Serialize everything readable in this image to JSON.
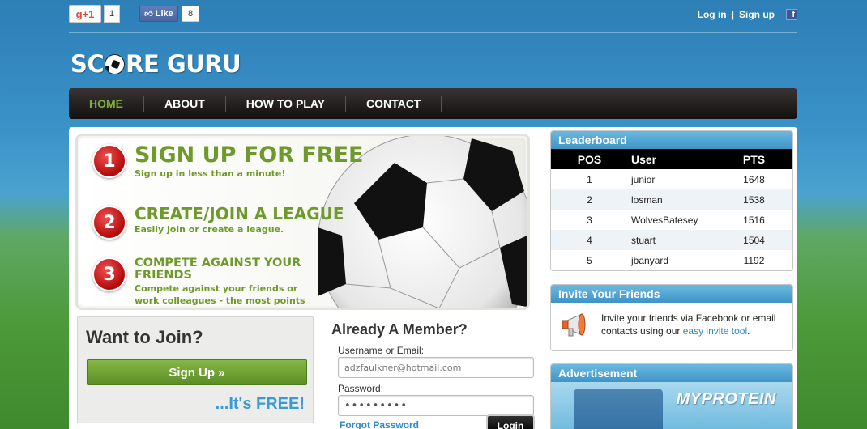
{
  "social": {
    "gplus_label": "+1",
    "gplus_icon": "g",
    "gplus_count": "1",
    "fb_like_label": "Like",
    "fb_like_count": "8"
  },
  "auth_links": {
    "login": "Log in",
    "separator": "|",
    "signup": "Sign up",
    "fb_icon": "f"
  },
  "logo": {
    "part1": "SC",
    "part2": "RE GURU"
  },
  "nav": [
    {
      "label": "HOME",
      "active": true
    },
    {
      "label": "ABOUT"
    },
    {
      "label": "HOW TO PLAY"
    },
    {
      "label": "CONTACT"
    }
  ],
  "hero": {
    "steps": [
      {
        "num": "1",
        "title": "SIGN UP FOR FREE",
        "sub": "Sign up in less than a minute!"
      },
      {
        "num": "2",
        "title": "CREATE/JOIN A LEAGUE",
        "sub": "Easily join or create a league."
      },
      {
        "num": "3",
        "title": "COMPETE AGAINST YOUR FRIENDS",
        "sub": "Compete against your friends or work colleagues - the most points wins!"
      }
    ]
  },
  "join": {
    "title": "Want to Join?",
    "button": "Sign Up »",
    "free": "...It's FREE!"
  },
  "member": {
    "title": "Already A Member?",
    "username_label": "Username or Email:",
    "username_value": "adzfaulkner@hotmail.com",
    "password_label": "Password:",
    "password_value": "•••••••••",
    "forgot": "Forgot Password",
    "login_button": "Login"
  },
  "leaderboard": {
    "title": "Leaderboard",
    "headers": [
      "POS",
      "User",
      "PTS"
    ],
    "rows": [
      {
        "pos": "1",
        "user": "junior",
        "pts": "1648"
      },
      {
        "pos": "2",
        "user": "losman",
        "pts": "1538"
      },
      {
        "pos": "3",
        "user": "WolvesBatesey",
        "pts": "1516"
      },
      {
        "pos": "4",
        "user": "stuart",
        "pts": "1504"
      },
      {
        "pos": "5",
        "user": "jbanyard",
        "pts": "1192"
      }
    ]
  },
  "invite": {
    "title": "Invite Your Friends",
    "text_before": "Invite your friends via Facebook or email contacts using our ",
    "link": "easy invite tool",
    "text_after": "."
  },
  "ad": {
    "title": "Advertisement",
    "brand": "MYPROTEIN"
  },
  "colors": {
    "accent_green": "#6e9a2c",
    "link_blue": "#2f8ac6",
    "nav_active": "#7db23a",
    "step_red": "#c81414"
  }
}
